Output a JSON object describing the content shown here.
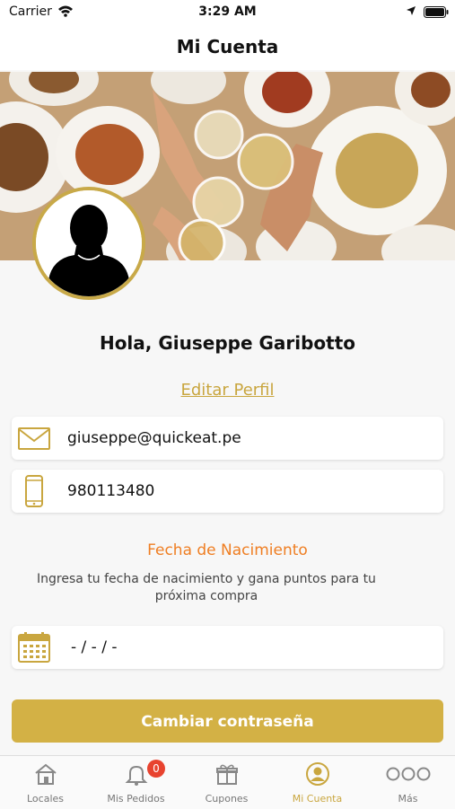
{
  "status_bar": {
    "carrier": "Carrier",
    "time": "3:29 AM"
  },
  "nav": {
    "title": "Mi Cuenta"
  },
  "profile": {
    "greeting": "Hola, Giuseppe Garibotto",
    "edit_label": "Editar Perfil"
  },
  "fields": {
    "email": "giuseppe@quickeat.pe",
    "phone": "980113480",
    "dob_placeholder": "- / - / -"
  },
  "birthday": {
    "title": "Fecha de Nacimiento",
    "description": "Ingresa tu fecha de nacimiento y gana puntos para tu próxima compra"
  },
  "buttons": {
    "change_password": "Cambiar contraseña"
  },
  "tabs": [
    {
      "label": "Locales",
      "icon": "house-icon",
      "active": false
    },
    {
      "label": "Mis Pedidos",
      "icon": "bell-icon",
      "active": false,
      "badge": "0"
    },
    {
      "label": "Cupones",
      "icon": "gift-icon",
      "active": false
    },
    {
      "label": "Mi Cuenta",
      "icon": "user-circle-icon",
      "active": true
    },
    {
      "label": "Más",
      "icon": "more-dots-icon",
      "active": false
    }
  ],
  "colors": {
    "accent": "#d3b145",
    "accent_text": "#c9a63f",
    "birthday_title": "#ef7e22",
    "badge": "#e8432f"
  }
}
